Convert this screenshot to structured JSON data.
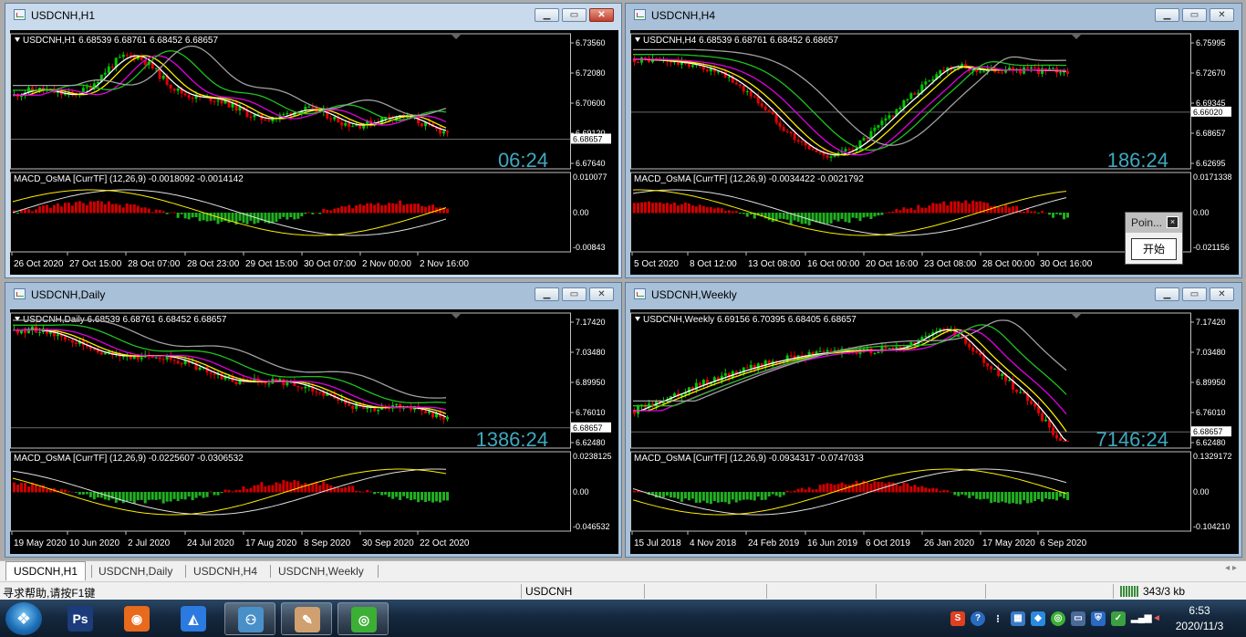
{
  "windows": [
    {
      "id": "h1",
      "title": "USDCNH,H1",
      "active": true,
      "header": "USDCNH,H1  6.68539 6.68761 6.68452 6.68657",
      "prices": [
        "6.73560",
        "6.72080",
        "6.70600",
        "6.69120",
        "6.68657",
        "6.67640"
      ],
      "macd_label": "MACD_OsMA [CurrTF] (12,26,9) -0.0018092 -0.0014142",
      "macd_scale": [
        "0.010077",
        "0.00",
        "-0.00843"
      ],
      "timer": "06:24",
      "dates": [
        "26 Oct 2020",
        "27 Oct 15:00",
        "28 Oct 07:00",
        "28 Oct 23:00",
        "29 Oct 15:00",
        "30 Oct 07:00",
        "2 Nov 00:00",
        "2 Nov 16:00"
      ]
    },
    {
      "id": "h4",
      "title": "USDCNH,H4",
      "active": false,
      "header": "USDCNH,H4  6.68539 6.68761 6.68452 6.68657",
      "prices": [
        "6.75995",
        "6.72670",
        "6.69345",
        "6.68657",
        "6.66020",
        "6.62695"
      ],
      "macd_label": "MACD_OsMA [CurrTF] (12,26,9) -0.0034422 -0.0021792",
      "macd_scale": [
        "0.0171338",
        "0.00",
        "-0.021156"
      ],
      "timer": "186:24",
      "dates": [
        "5 Oct 2020",
        "8 Oct 12:00",
        "13 Oct 08:00",
        "16 Oct 00:00",
        "20 Oct 16:00",
        "23 Oct 08:00",
        "28 Oct 00:00",
        "30 Oct 16:00"
      ]
    },
    {
      "id": "daily",
      "title": "USDCNH,Daily",
      "active": false,
      "header": "USDCNH,Daily  6.68539 6.68761 6.68452 6.68657",
      "prices": [
        "7.17420",
        "7.03480",
        "6.89950",
        "6.76010",
        "6.68657",
        "6.62480"
      ],
      "macd_label": "MACD_OsMA [CurrTF] (12,26,9) -0.0225607 -0.0306532",
      "macd_scale": [
        "0.0238125",
        "0.00",
        "-0.046532"
      ],
      "timer": "1386:24",
      "dates": [
        "19 May 2020",
        "10 Jun 2020",
        "2 Jul 2020",
        "24 Jul 2020",
        "17 Aug 2020",
        "8 Sep 2020",
        "30 Sep 2020",
        "22 Oct 2020"
      ]
    },
    {
      "id": "weekly",
      "title": "USDCNH,Weekly",
      "active": false,
      "header": "USDCNH,Weekly  6.69156 6.70395 6.68405 6.68657",
      "prices": [
        "7.17420",
        "7.03480",
        "6.89950",
        "6.76010",
        "6.68657",
        "6.62480"
      ],
      "macd_label": "MACD_OsMA [CurrTF] (12,26,9) -0.0934317 -0.0747033",
      "macd_scale": [
        "0.1329172",
        "0.00",
        "-0.104210"
      ],
      "timer": "7146:24",
      "dates": [
        "15 Jul 2018",
        "4 Nov 2018",
        "24 Feb 2019",
        "16 Jun 2019",
        "6 Oct 2019",
        "26 Jan 2020",
        "17 May 2020",
        "6 Sep 2020"
      ]
    }
  ],
  "tabs": [
    "USDCNH,H1",
    "USDCNH,Daily",
    "USDCNH,H4",
    "USDCNH,Weekly"
  ],
  "tab_arrows": "◂  ▸",
  "status": {
    "help": "寻求帮助,请按F1键",
    "symbol": "USDCNH",
    "traffic": "343/3 kb"
  },
  "popup": {
    "title": "Poin...",
    "button": "开始"
  },
  "taskbar": {
    "apps": [
      {
        "name": "photoshop",
        "glyph": "Ps",
        "color": "#1b3b7a",
        "open": false
      },
      {
        "name": "browser",
        "glyph": "◉",
        "color": "#e86a1c",
        "open": false
      },
      {
        "name": "feishu",
        "glyph": "◭",
        "color": "#2a7ae0",
        "open": false
      },
      {
        "name": "metatrader",
        "glyph": "⚇",
        "color": "#4a90c8",
        "open": true
      },
      {
        "name": "paint",
        "glyph": "✎",
        "color": "#d0a070",
        "open": true
      },
      {
        "name": "wechat",
        "glyph": "◎",
        "color": "#3cb034",
        "open": true
      }
    ],
    "time": "6:53",
    "date": "2020/11/3"
  },
  "colors": {
    "bull": "#00c800",
    "bear": "#e60000",
    "ma_white": "#ffffff",
    "ma_yellow": "#ffee00",
    "ma_magenta": "#e000e0",
    "ma_green": "#20c020",
    "ma_gray": "#a0a0a0",
    "timer": "#3fa8c0"
  }
}
